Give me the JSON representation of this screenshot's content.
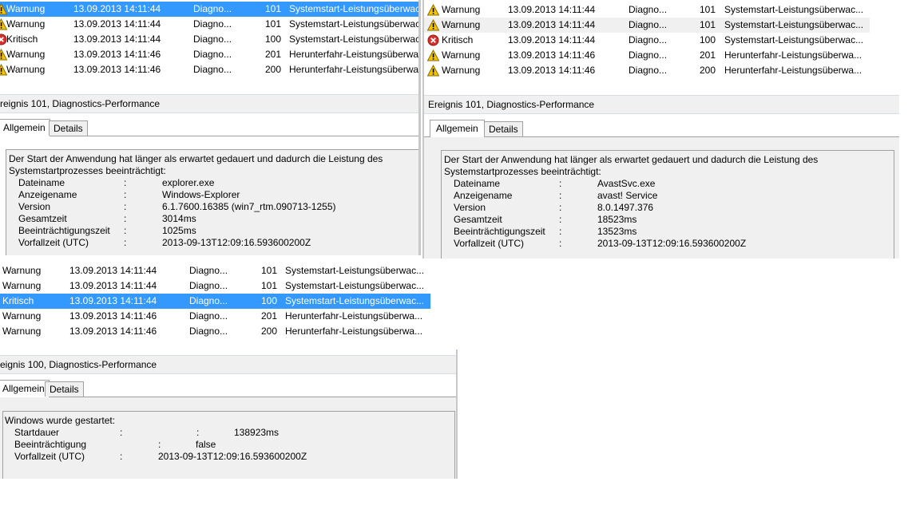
{
  "panels": [
    {
      "rows": [
        {
          "level": "Warnung",
          "icon": "warning-icon",
          "date": "13.09.2013 14:11:44",
          "source": "Diagno...",
          "id": "101",
          "task": "Systemstart-Leistungsüberwac",
          "selected": true
        },
        {
          "level": "Warnung",
          "icon": "warning-icon",
          "date": "13.09.2013 14:11:44",
          "source": "Diagno...",
          "id": "101",
          "task": "Systemstart-Leistungsüberwac"
        },
        {
          "level": "Kritisch",
          "icon": "error-icon",
          "date": "13.09.2013 14:11:44",
          "source": "Diagno...",
          "id": "100",
          "task": "Systemstart-Leistungsüberwac"
        },
        {
          "level": "Warnung",
          "icon": "warning-icon",
          "date": "13.09.2013 14:11:46",
          "source": "Diagno...",
          "id": "201",
          "task": "Herunterfahr-Leistungsüberwa"
        },
        {
          "level": "Warnung",
          "icon": "warning-icon",
          "date": "13.09.2013 14:11:46",
          "source": "Diagno...",
          "id": "200",
          "task": "Herunterfahr-Leistungsüberwa"
        }
      ],
      "event_title": "reignis 101, Diagnostics-Performance",
      "tab_general": "Allgemein",
      "tab_details": "Details",
      "desc_line1": "Der Start der Anwendung hat länger als erwartet gedauert und dadurch die Leistung des",
      "desc_line2": "Systemstartprozesses beeinträchtigt:",
      "props": [
        {
          "label": "Dateiname",
          "sep": ":",
          "value": "explorer.exe"
        },
        {
          "label": "Anzeigename",
          "sep": ":",
          "value": "Windows-Explorer"
        },
        {
          "label": "Version",
          "sep": ":",
          "value": "6.1.7600.16385 (win7_rtm.090713-1255)"
        },
        {
          "label": "Gesamtzeit",
          "sep": ":",
          "value": "3014ms"
        },
        {
          "label": "Beeinträchtigungszeit",
          "sep": ":",
          "value": "1025ms"
        },
        {
          "label": "Vorfallzeit (UTC)",
          "sep": ":",
          "value": "2013-09-13T12:09:16.593600200Z"
        }
      ]
    },
    {
      "rows": [
        {
          "level": "Warnung",
          "icon": "warning-icon",
          "date": "13.09.2013 14:11:44",
          "source": "Diagno...",
          "id": "101",
          "task": "Systemstart-Leistungsüberwac..."
        },
        {
          "level": "Warnung",
          "icon": "warning-icon",
          "date": "13.09.2013 14:11:44",
          "source": "Diagno...",
          "id": "101",
          "task": "Systemstart-Leistungsüberwac...",
          "alt": true
        },
        {
          "level": "Kritisch",
          "icon": "error-icon",
          "date": "13.09.2013 14:11:44",
          "source": "Diagno...",
          "id": "100",
          "task": "Systemstart-Leistungsüberwac..."
        },
        {
          "level": "Warnung",
          "icon": "warning-icon",
          "date": "13.09.2013 14:11:46",
          "source": "Diagno...",
          "id": "201",
          "task": "Herunterfahr-Leistungsüberwa..."
        },
        {
          "level": "Warnung",
          "icon": "warning-icon",
          "date": "13.09.2013 14:11:46",
          "source": "Diagno...",
          "id": "200",
          "task": "Herunterfahr-Leistungsüberwa..."
        }
      ],
      "event_title": "Ereignis 101, Diagnostics-Performance",
      "tab_general": "Allgemein",
      "tab_details": "Details",
      "desc_line1": "Der Start der Anwendung hat länger als erwartet gedauert und dadurch die Leistung des",
      "desc_line2": "Systemstartprozesses beeinträchtigt:",
      "props": [
        {
          "label": "Dateiname",
          "sep": ":",
          "value": "AvastSvc.exe"
        },
        {
          "label": "Anzeigename",
          "sep": ":",
          "value": "avast! Service"
        },
        {
          "label": "Version",
          "sep": ":",
          "value": "8.0.1497.376"
        },
        {
          "label": "Gesamtzeit",
          "sep": ":",
          "value": "18523ms"
        },
        {
          "label": "Beeinträchtigungszeit",
          "sep": ":",
          "value": "13523ms"
        },
        {
          "label": "Vorfallzeit (UTC)",
          "sep": ":",
          "value": "2013-09-13T12:09:16.593600200Z"
        }
      ]
    },
    {
      "rows": [
        {
          "level": "Warnung",
          "icon": "warning-icon",
          "date": "13.09.2013 14:11:44",
          "source": "Diagno...",
          "id": "101",
          "task": "Systemstart-Leistungsüberwac..."
        },
        {
          "level": "Warnung",
          "icon": "warning-icon",
          "date": "13.09.2013 14:11:44",
          "source": "Diagno...",
          "id": "101",
          "task": "Systemstart-Leistungsüberwac..."
        },
        {
          "level": "Kritisch",
          "icon": "error-icon",
          "date": "13.09.2013 14:11:44",
          "source": "Diagno...",
          "id": "100",
          "task": "Systemstart-Leistungsüberwac...",
          "selected": true
        },
        {
          "level": "Warnung",
          "icon": "warning-icon",
          "date": "13.09.2013 14:11:46",
          "source": "Diagno...",
          "id": "201",
          "task": "Herunterfahr-Leistungsüberwa..."
        },
        {
          "level": "Warnung",
          "icon": "warning-icon",
          "date": "13.09.2013 14:11:46",
          "source": "Diagno...",
          "id": "200",
          "task": "Herunterfahr-Leistungsüberwa..."
        }
      ],
      "event_title": "eignis 100, Diagnostics-Performance",
      "tab_general": "Allgemein",
      "tab_details": "Details",
      "desc_line1": "Windows wurde gestartet:",
      "props": [
        {
          "label": "Startdauer",
          "sep": ":",
          "sep2": ":",
          "value": "138923ms"
        },
        {
          "label": "Beeinträchtigung",
          "sep": ":",
          "value": "false"
        },
        {
          "label": "Vorfallzeit (UTC)",
          "sep": ":",
          "value": "2013-09-13T12:09:16.593600200Z"
        }
      ]
    }
  ],
  "colors": {
    "selection": "#3399ff",
    "warning": "#f5c400",
    "error": "#d9302c"
  }
}
